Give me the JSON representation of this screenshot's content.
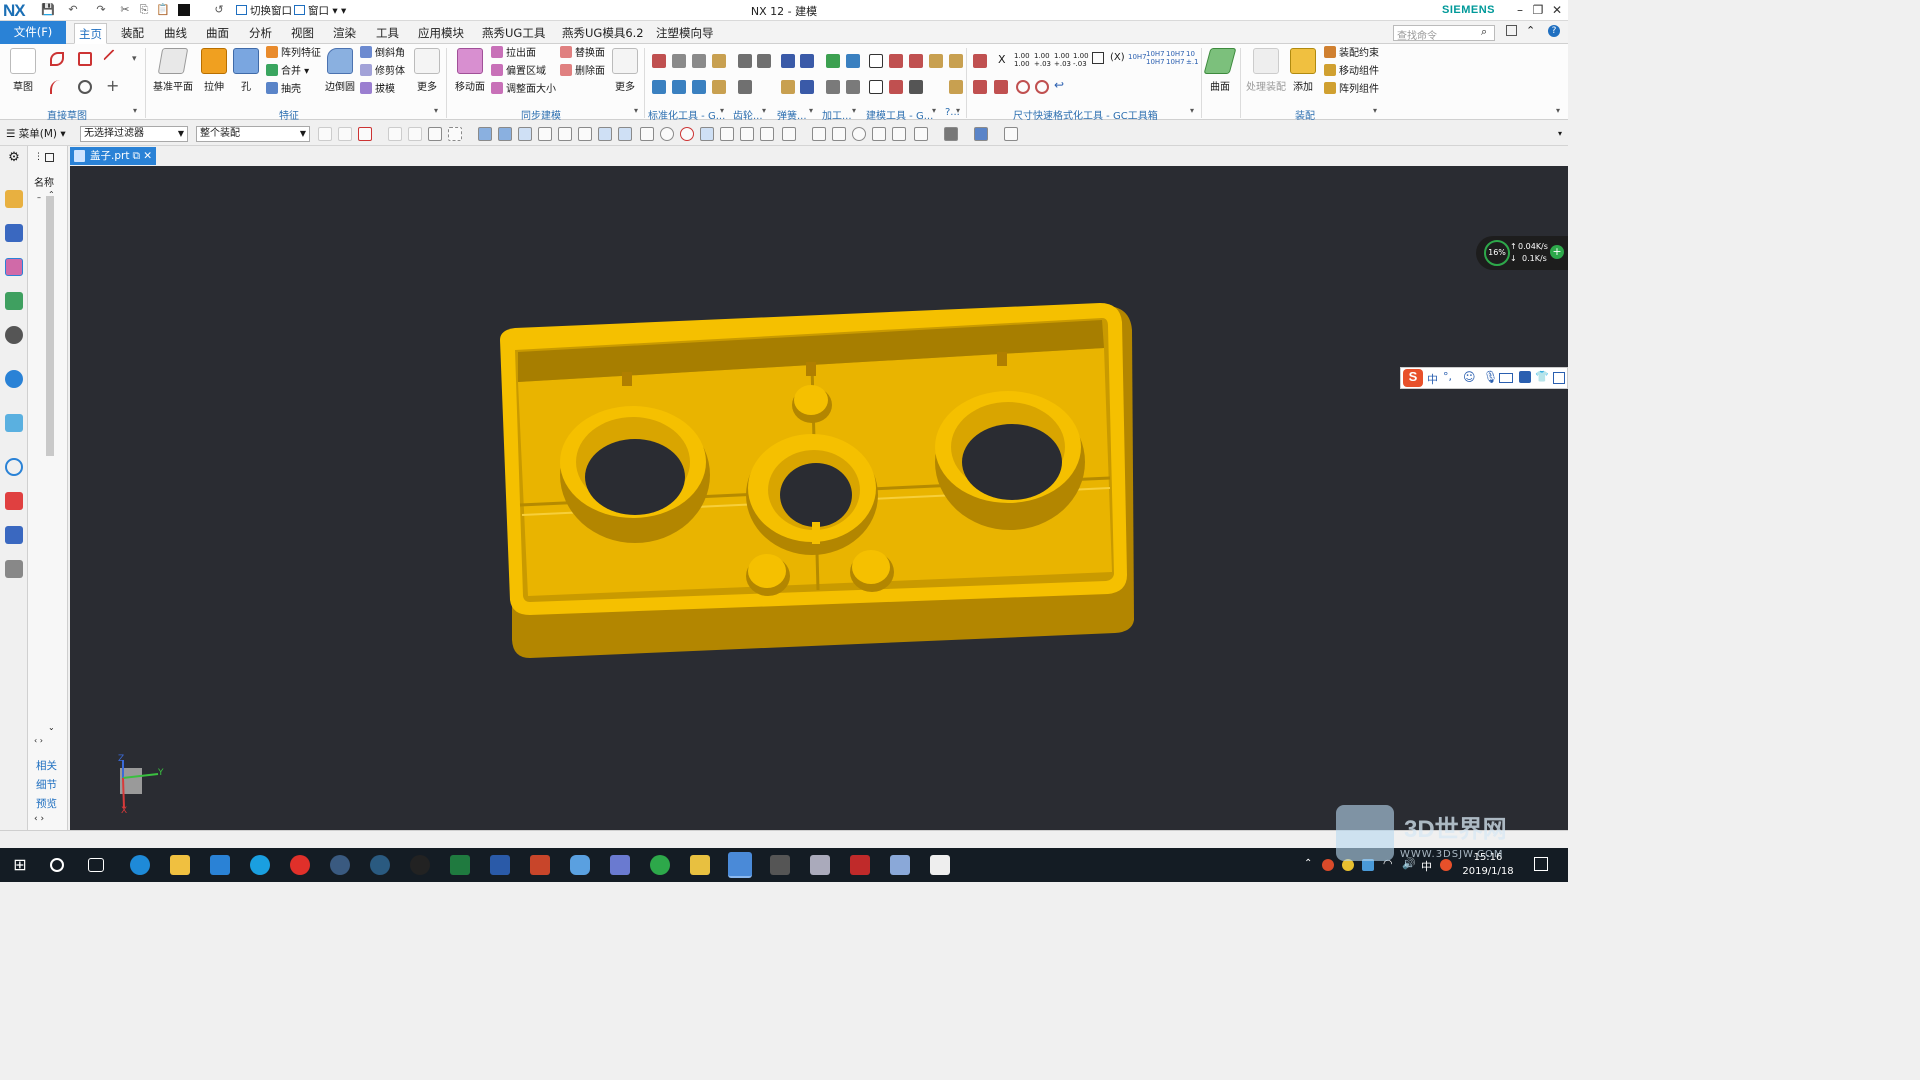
{
  "titlebar": {
    "logo": "NX",
    "title": "NX 12 - 建模",
    "brand": "SIEMENS",
    "switch_window": "切换窗口",
    "window_menu": "窗口"
  },
  "tabs": {
    "file": "文件(F)",
    "items": [
      "主页",
      "装配",
      "曲线",
      "曲面",
      "分析",
      "视图",
      "渲染",
      "工具",
      "应用模块",
      "燕秀UG工具",
      "燕秀UG模具6.2",
      "注塑模向导"
    ],
    "active": "主页"
  },
  "search": {
    "placeholder": "查找命令"
  },
  "ribbon": {
    "sketch": {
      "label": "草图",
      "group": "直接草图"
    },
    "datum_plane": "基准平面",
    "extrude": "拉伸",
    "hole": "孔",
    "pattern_feature": "阵列特征",
    "unite": "合并",
    "shell": "抽壳",
    "edge_blend": "边倒圆",
    "chamfer": "倒斜角",
    "trim_body": "修剪体",
    "draft": "拔模",
    "more_feature": "更多",
    "feature_group": "特征",
    "move_face": "移动面",
    "pull_face": "拉出面",
    "offset_region": "偏置区域",
    "resize_face": "调整面大小",
    "replace_face": "替换面",
    "delete_face": "删除面",
    "more_sync": "更多",
    "sync_group": "同步建模",
    "std_tools": "标准化工具 - G...",
    "gear": "齿轮...",
    "spring": "弹簧...",
    "machining": "加工...",
    "modeling_tools": "建模工具 - G...",
    "more_dots": "?...",
    "dim_tools": "尺寸快速格式化工具 - GC工具箱",
    "surface": "曲面",
    "process_assembly": "处理装配",
    "add": "添加",
    "assembly_constraint": "装配约束",
    "move_component": "移动组件",
    "pattern_component": "阵列组件",
    "assembly_group": "装配",
    "dim_labels": [
      "1.00 1.00",
      "1.00 +.03",
      "1.00 +.03",
      "1.00 -.03",
      "(X)",
      "10H7",
      "10H7 10H7",
      "10H7 10H7",
      "10 ±.1"
    ]
  },
  "selbar": {
    "menu": "菜单(M)",
    "filter": "无选择过滤器",
    "scope": "整个装配"
  },
  "navigator": {
    "header": "名称",
    "links": [
      "相关",
      "细节",
      "预览"
    ]
  },
  "document": {
    "tab": "盖子.prt"
  },
  "viewport": {
    "bg": "#2a2c32",
    "part_color": "#f5c000",
    "triad": {
      "x": "X",
      "y": "Y",
      "z": "Z"
    }
  },
  "netmeter": {
    "percent": "16%",
    "up": "0.04K/s",
    "down": "0.1K/s"
  },
  "ime": {
    "lang": "中"
  },
  "taskbar": {
    "time": "15:16",
    "date": "2019/1/18",
    "lang": "中"
  },
  "watermark": {
    "text": "3D世界网",
    "url": "WWW.3DSJW.COM"
  }
}
